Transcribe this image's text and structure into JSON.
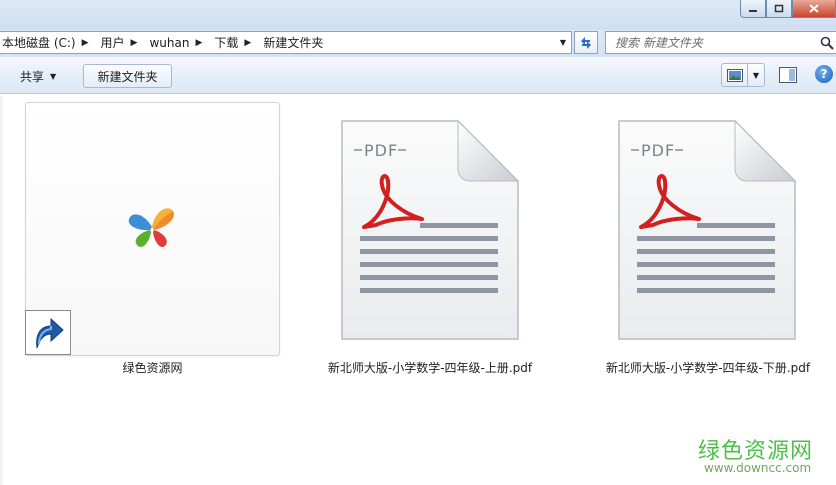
{
  "window": {
    "controls": [
      "minimize",
      "maximize",
      "close"
    ]
  },
  "address_bar": {
    "crumbs": [
      "本地磁盘 (C:)",
      "用户",
      "wuhan",
      "下载",
      "新建文件夹"
    ]
  },
  "search": {
    "placeholder": "搜索 新建文件夹"
  },
  "toolbar": {
    "share_label": "共享",
    "new_folder_label": "新建文件夹"
  },
  "files": [
    {
      "name": "绿色资源网",
      "type": "shortcut",
      "icon": "msn-butterfly-icon"
    },
    {
      "name": "新北师大版-小学数学-四年级-上册.pdf",
      "type": "pdf",
      "icon": "pdf-file-icon",
      "badge": "PDF"
    },
    {
      "name": "新北师大版-小学数学-四年级-下册.pdf",
      "type": "pdf",
      "icon": "pdf-file-icon",
      "badge": "PDF"
    }
  ],
  "watermark": {
    "title": "绿色资源网",
    "url": "www.downcc.com"
  },
  "colors": {
    "chrome_blue": "#dbe8f6",
    "pdf_red": "#d21f1f",
    "watermark_green": "#4dbf4a"
  }
}
